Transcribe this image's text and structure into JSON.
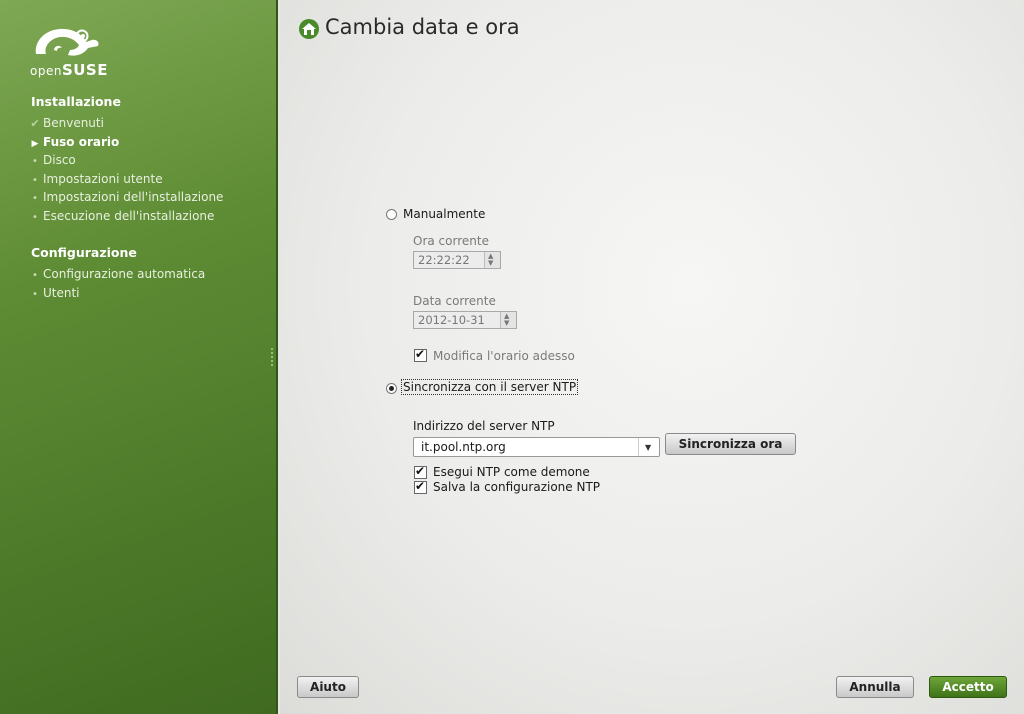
{
  "brand": {
    "small": "open",
    "big": "SUSE"
  },
  "sidebar": {
    "installazione_title": "Installazione",
    "steps": [
      {
        "label": "Benvenuti",
        "state": "done"
      },
      {
        "label": "Fuso orario",
        "state": "current"
      },
      {
        "label": "Disco",
        "state": "todo"
      },
      {
        "label": "Impostazioni utente",
        "state": "todo"
      },
      {
        "label": "Impostazioni dell'installazione",
        "state": "todo"
      },
      {
        "label": "Esecuzione dell'installazione",
        "state": "todo"
      }
    ],
    "configurazione_title": "Configurazione",
    "config_steps": [
      {
        "label": "Configurazione automatica"
      },
      {
        "label": "Utenti"
      }
    ]
  },
  "page": {
    "title": "Cambia data e ora"
  },
  "manual": {
    "label": "Manualmente",
    "selected": false,
    "time_label": "Ora corrente",
    "time_value": "22:22:22",
    "date_label": "Data corrente",
    "date_value": "2012-10-31",
    "modify_now_label": "Modifica l'orario adesso",
    "modify_now_checked": true
  },
  "ntp": {
    "label": "Sincronizza con il server NTP",
    "selected": true,
    "server_label": "Indirizzo del server NTP",
    "server_value": "it.pool.ntp.org",
    "sync_button": "Sincronizza ora",
    "daemon_label": "Esegui NTP come demone",
    "daemon_checked": true,
    "save_label": "Salva la configurazione NTP",
    "save_checked": true
  },
  "footer": {
    "help": "Aiuto",
    "cancel": "Annulla",
    "accept": "Accetto"
  },
  "colors": {
    "sidebar": "#5f8d35",
    "accept": "#4f8a24"
  }
}
